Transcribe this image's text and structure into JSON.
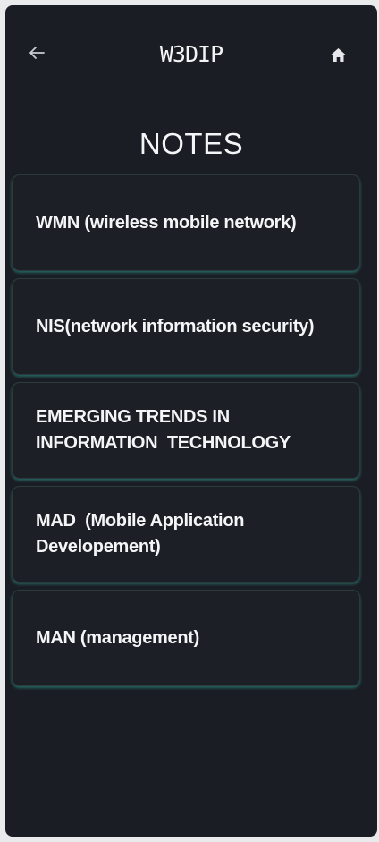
{
  "header": {
    "app_title": "W3DIP",
    "back_icon": "arrow-left-icon",
    "home_icon": "home-icon"
  },
  "page_title": "NOTES",
  "notes": [
    {
      "label": "WMN (wireless mobile network)"
    },
    {
      "label": "NIS(network information security)"
    },
    {
      "label": "EMERGING TRENDS IN INFORMATION  TECHNOLOGY"
    },
    {
      "label": "MAD  (Mobile Application Developement)"
    },
    {
      "label": "MAN (management)"
    }
  ],
  "colors": {
    "background": "#1b1d24",
    "card": "#1c1f26",
    "card_glow": "#2ba391",
    "text": "#f4f5f7"
  }
}
